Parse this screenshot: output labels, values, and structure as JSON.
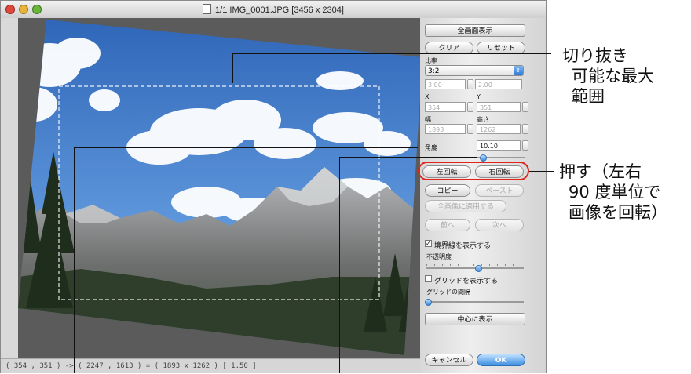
{
  "window": {
    "title": "1/1 IMG_0001.JPG [3456 x 2304]",
    "status": "( 354 , 351 ) -> ( 2247 , 1613 ) = ( 1893 x 1262 ) [ 1.50 ]"
  },
  "panel": {
    "fit_button": "全画面表示",
    "clear_button": "クリア",
    "reset_button": "リセット",
    "ratio_label": "比率",
    "ratio_value": "3:2",
    "ratio_w": "3.00",
    "ratio_h": "2.00",
    "x_label": "X",
    "y_label": "Y",
    "x_value": "354",
    "y_value": "351",
    "width_label": "幅",
    "height_label": "高さ",
    "width_value": "1893",
    "height_value": "1262",
    "angle_label": "角度",
    "angle_value": "10.10",
    "rotate_left": "左回転",
    "rotate_right": "右回転",
    "copy_button": "コピー",
    "paste_button": "ペースト",
    "apply_all_button": "全画像に適用する",
    "prev_button": "前へ",
    "next_button": "次へ",
    "show_border_label": "境界線を表示する",
    "opacity_label": "不透明度",
    "show_grid_label": "グリッドを表示する",
    "grid_spacing_label": "グリッドの間隔",
    "center_button": "中心に表示",
    "cancel_button": "キャンセル",
    "ok_button": "OK",
    "show_border_checked": true,
    "show_grid_checked": false
  },
  "callouts": {
    "crop_max": [
      "切り抜き",
      "可能な最大",
      "範囲"
    ],
    "press_rotate": [
      "押す（左右",
      "90 度単位で",
      "画像を回転）"
    ]
  },
  "colors": {
    "accent_blue": "#3d8fe0",
    "highlight_red": "#e2231a",
    "sky": "#3f78c8"
  }
}
